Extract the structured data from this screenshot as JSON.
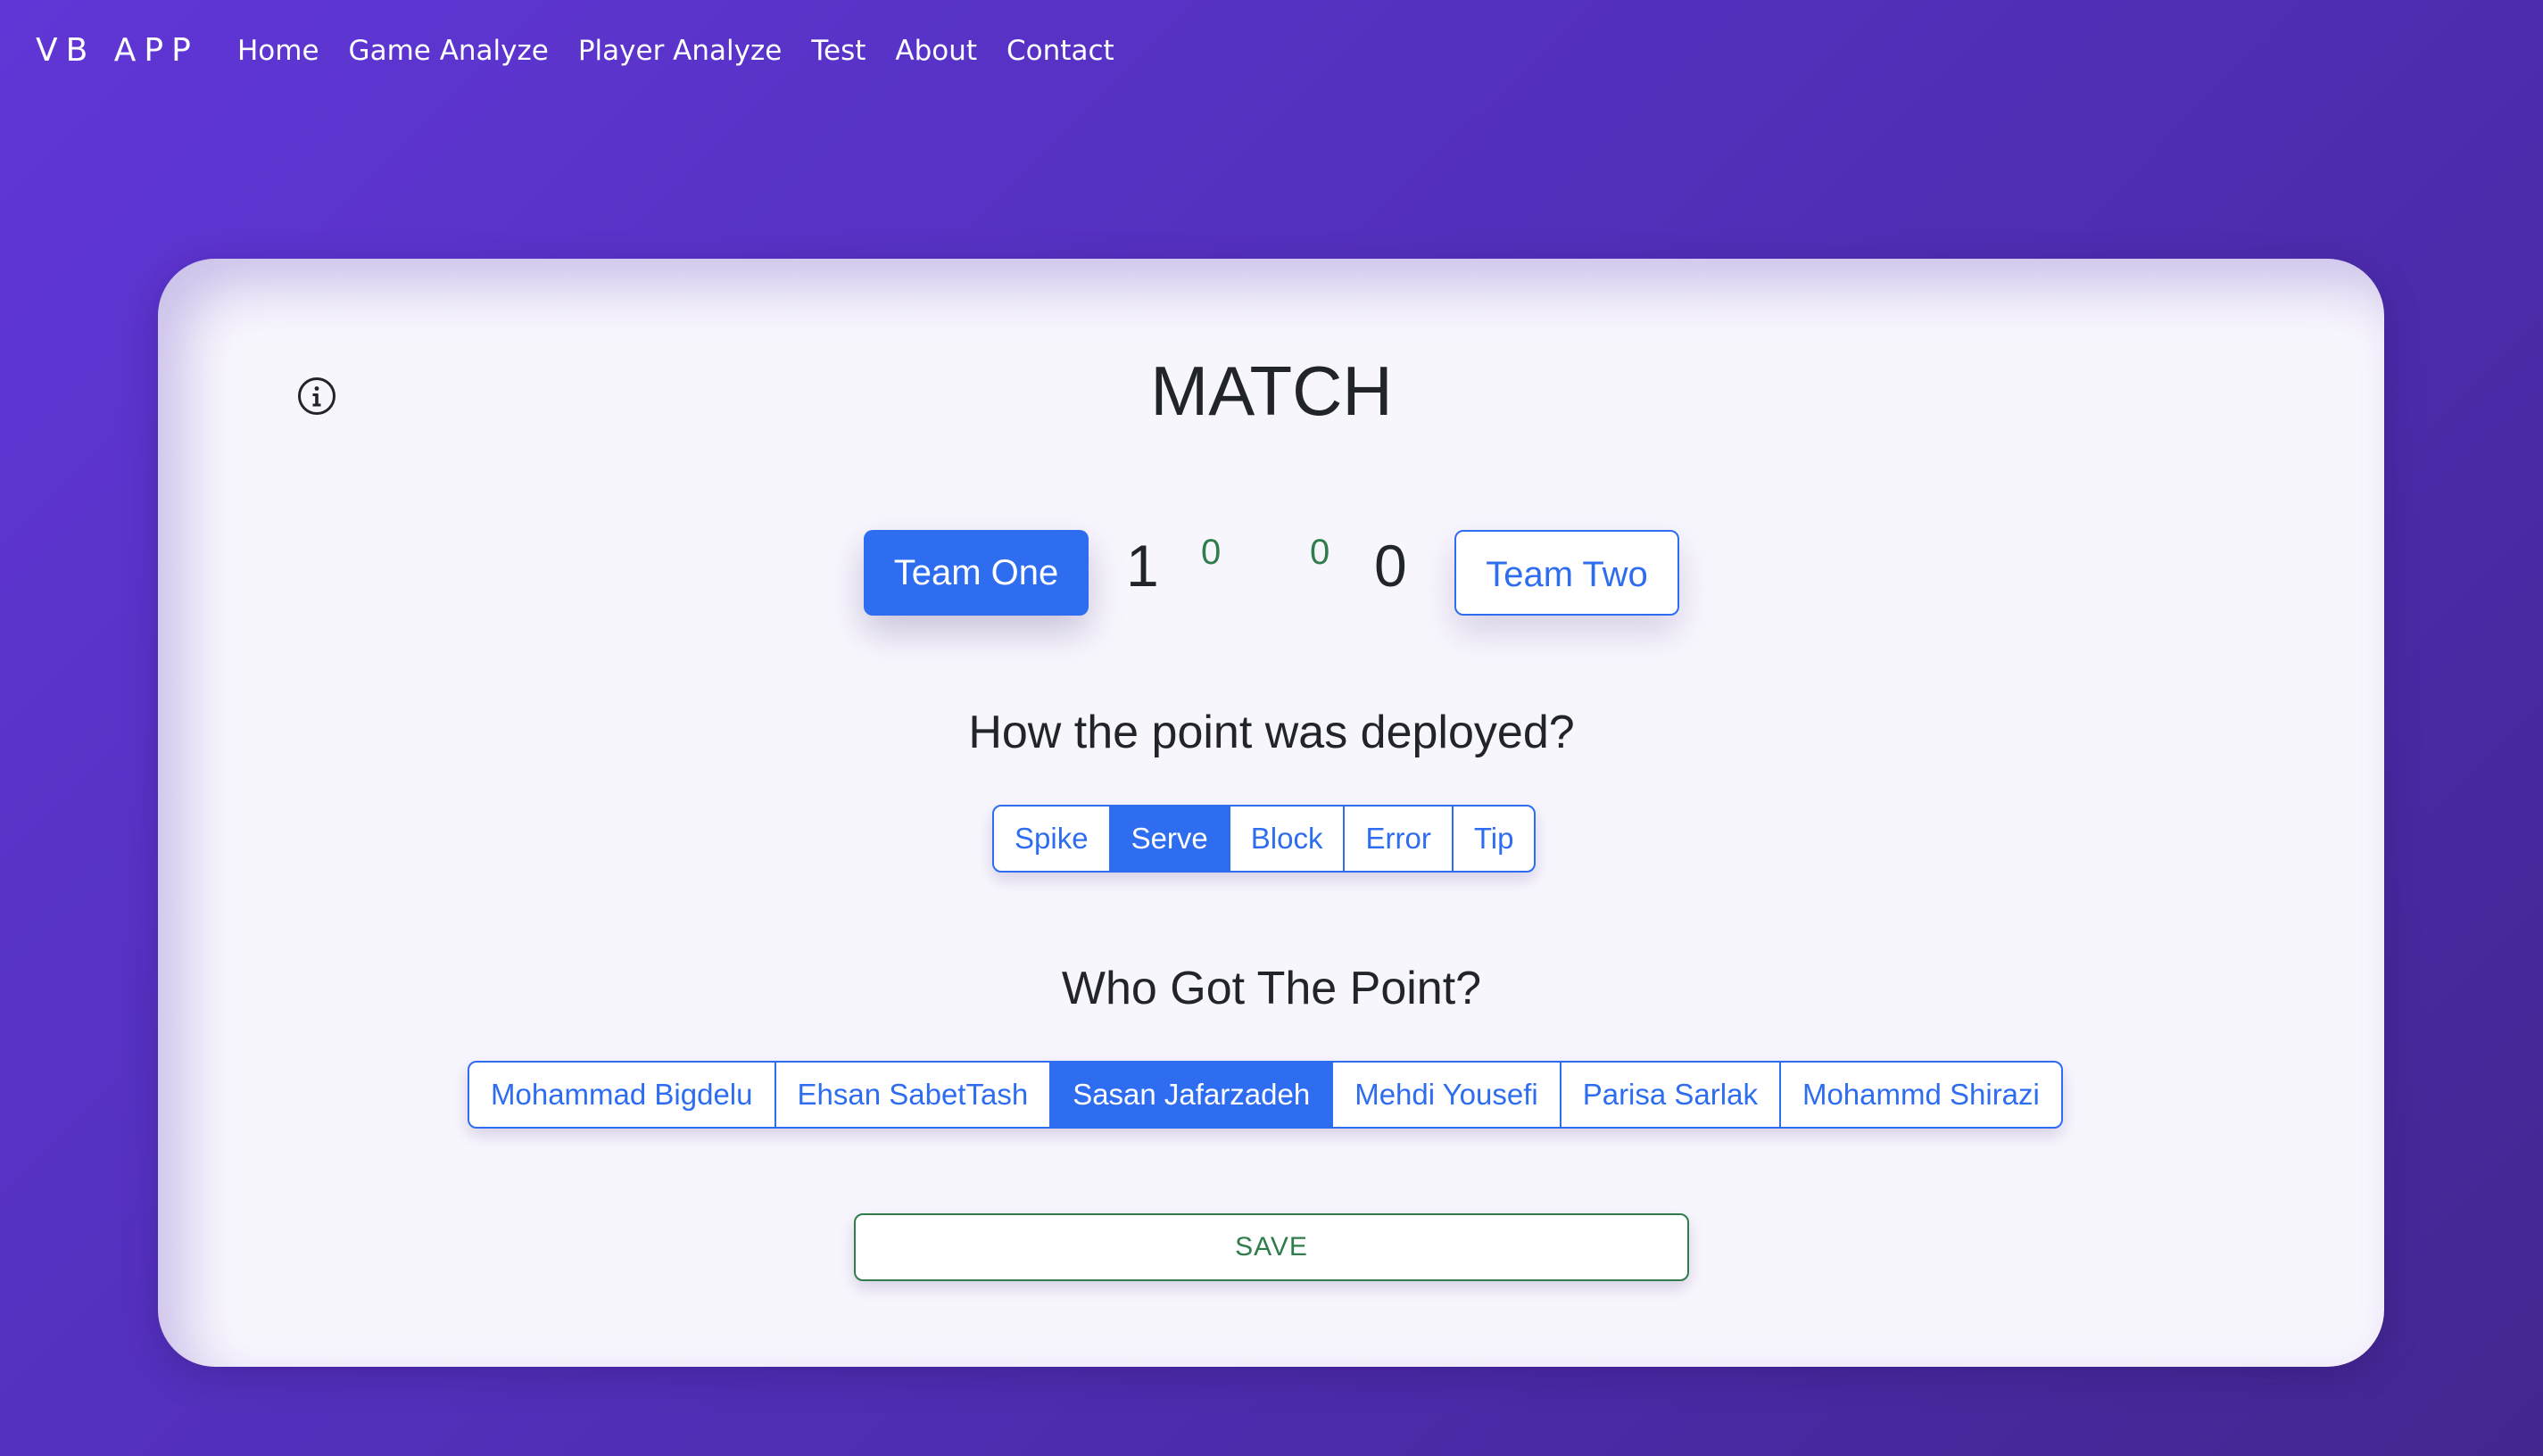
{
  "navbar": {
    "brand": "VB APP",
    "links": [
      {
        "label": "Home"
      },
      {
        "label": "Game Analyze"
      },
      {
        "label": "Player Analyze"
      },
      {
        "label": "Test"
      },
      {
        "label": "About"
      },
      {
        "label": "Contact"
      }
    ]
  },
  "match": {
    "title": "MATCH",
    "info_icon": "info-icon",
    "team_one": {
      "label": "Team One",
      "score": "1",
      "sets": "0",
      "selected": true
    },
    "team_two": {
      "label": "Team Two",
      "score": "0",
      "sets": "0",
      "selected": false
    }
  },
  "deploy": {
    "question": "How the point was deployed?",
    "options": [
      {
        "label": "Spike",
        "active": false
      },
      {
        "label": "Serve",
        "active": true
      },
      {
        "label": "Block",
        "active": false
      },
      {
        "label": "Error",
        "active": false
      },
      {
        "label": "Tip",
        "active": false
      }
    ]
  },
  "players": {
    "question": "Who Got The Point?",
    "options": [
      {
        "label": "Mohammad Bigdelu",
        "active": false
      },
      {
        "label": "Ehsan SabetTash",
        "active": false
      },
      {
        "label": "Sasan Jafarzadeh",
        "active": true
      },
      {
        "label": "Mehdi Yousefi",
        "active": false
      },
      {
        "label": "Parisa Sarlak",
        "active": false
      },
      {
        "label": "Mohammd Shirazi",
        "active": false
      }
    ]
  },
  "save": {
    "label": "SAVE"
  },
  "colors": {
    "accent": "#2f6df0",
    "success": "#2e7d4a",
    "background_start": "#6036d6",
    "background_end": "#43278f"
  }
}
